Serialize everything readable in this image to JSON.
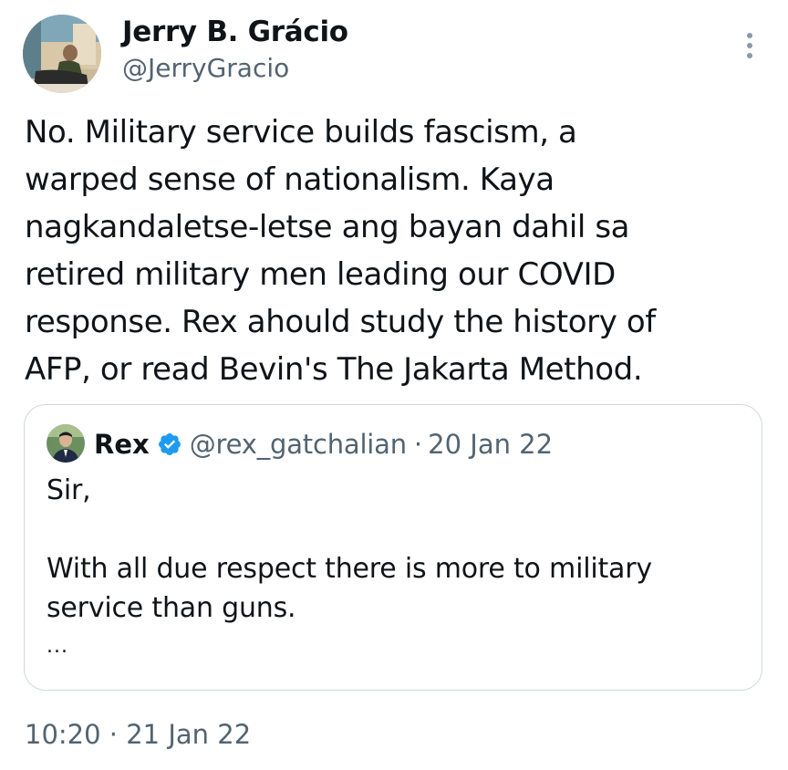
{
  "author": {
    "display_name": "Jerry B. Grácio",
    "handle": "@JerryGracio",
    "avatar": "profile-photo"
  },
  "tweet": {
    "text": "No. Military service builds fascism, a\nwarped sense of nationalism. Kaya\nnagkandaletse-letse ang bayan dahil sa\nretired military men leading our COVID\nresponse. Rex ahould study the history of\nAFP, or read Bevin's The Jakarta Method.",
    "timestamp": "10:20 · 21 Jan 22",
    "more_icon": "more-vertical-icon"
  },
  "quoted_tweet": {
    "display_name": "Rex",
    "verified_icon": "verified-badge-icon",
    "handle": "@rex_gatchalian",
    "separator": "·",
    "date": "20 Jan 22",
    "text": "Sir,\n\nWith all due respect there is more to military\nservice than guns.",
    "truncation": "..."
  },
  "colors": {
    "text_primary": "#0f1419",
    "text_secondary": "#536471",
    "border": "#cfd9de",
    "verified_blue": "#1d9bf0"
  }
}
